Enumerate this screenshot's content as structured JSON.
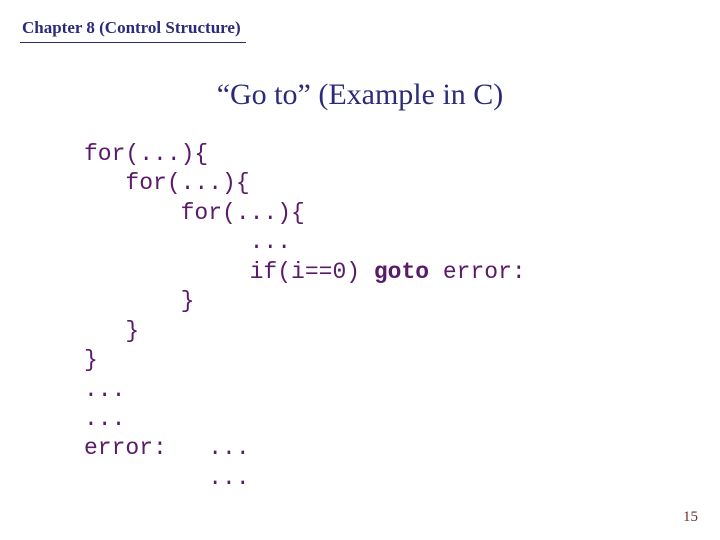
{
  "header": {
    "chapter": "Chapter 8 (Control Structure)"
  },
  "title": "“Go to”  (Example in C)",
  "code": {
    "lines": [
      "for(...){",
      "   for(...){",
      "       for(...){",
      "            ...",
      "            if(i==0) ",
      "       }",
      "   }",
      "}",
      "...",
      "...",
      "error:   ...",
      "         ..."
    ],
    "goto_kw": "goto",
    "goto_tail": " error:"
  },
  "pagenum": "15"
}
